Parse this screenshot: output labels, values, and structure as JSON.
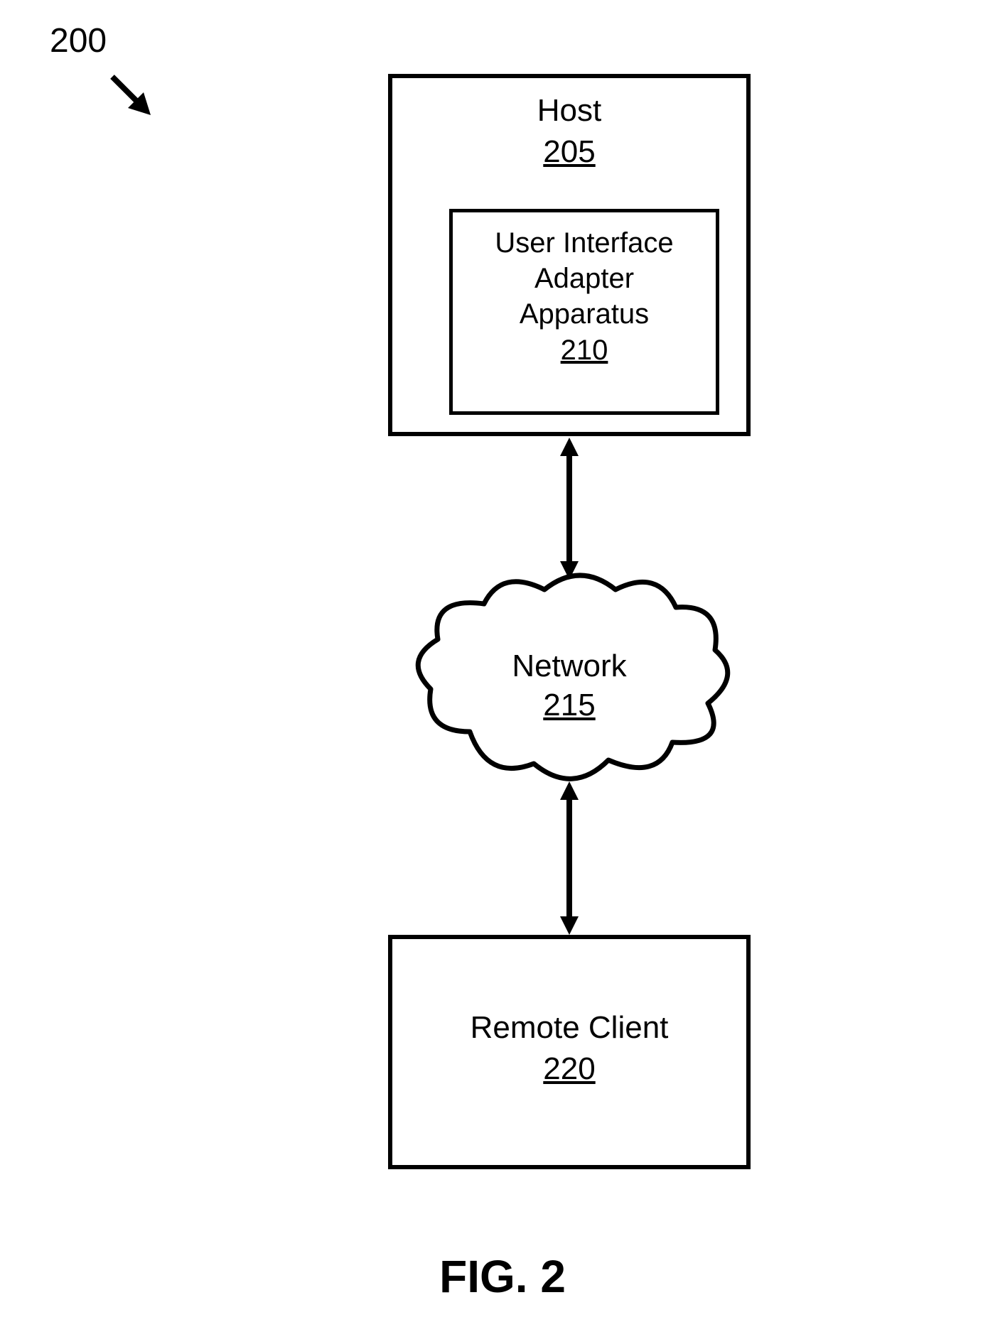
{
  "figure_ref": "200",
  "host": {
    "label": "Host",
    "ref": "205",
    "inner": {
      "label_line1": "User Interface",
      "label_line2": "Adapter",
      "label_line3": "Apparatus",
      "ref": "210"
    }
  },
  "network": {
    "label": "Network",
    "ref": "215"
  },
  "client": {
    "label": "Remote Client",
    "ref": "220"
  },
  "caption": "FIG. 2"
}
